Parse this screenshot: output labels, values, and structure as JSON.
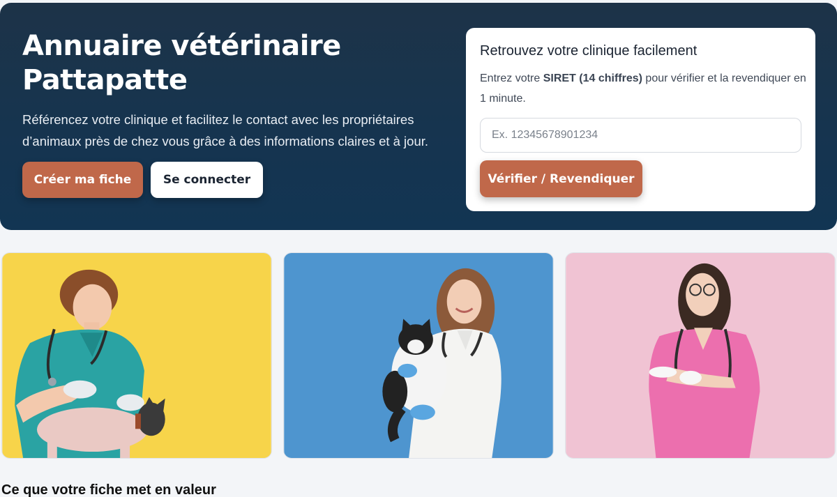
{
  "hero": {
    "title_line1": "Annuaire vétérinaire",
    "title_line2": "Pattapatte",
    "description": "Référencez votre clinique et facilitez le contact avec les propriétaires d’animaux près de chez vous grâce à des informations claires et à jour.",
    "create_button": "Créer ma fiche",
    "login_button": "Se connecter"
  },
  "claim": {
    "title": "Retrouvez votre clinique facilement",
    "text_before": "Entrez votre ",
    "text_bold": "SIRET (14 chiffres)",
    "text_after": " pour vérifier et la revendiquer en 1 minute.",
    "input_placeholder": "Ex. 12345678901234",
    "input_value": "",
    "submit_button": "Vérifier / Revendiquer"
  },
  "photos": [
    {
      "subject": "vet-with-dog",
      "background": "#f7d44a"
    },
    {
      "subject": "vet-with-cat",
      "background": "#4e95cf"
    },
    {
      "subject": "vet-pink-scrubs",
      "background": "#f0c3d3"
    }
  ],
  "colors": {
    "accent": "#c0684a",
    "hero_bg": "#17344f",
    "page_bg": "#f3f5f8"
  },
  "section": {
    "title": "Ce que votre fiche met en valeur"
  }
}
